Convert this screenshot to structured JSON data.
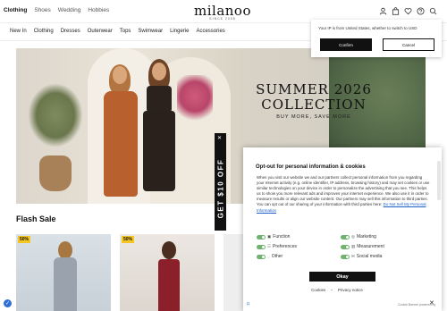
{
  "header": {
    "categories": [
      "Clothing",
      "Shoes",
      "Wedding",
      "Hobbies"
    ],
    "logo_text": "milanoo",
    "logo_since": "SINCE 2008",
    "icons": [
      "user-icon",
      "bag-icon",
      "heart-icon",
      "help-icon",
      "search-icon"
    ]
  },
  "nav": {
    "items": [
      "New In",
      "Clothing",
      "Dresses",
      "Outerwear",
      "Tops",
      "Swimwear",
      "Lingerie",
      "Accessories"
    ]
  },
  "hero": {
    "title_line1": "SUMMER 2026",
    "title_line2": "COLLECTION",
    "subtitle": "BUY MORE, SAVE MORE"
  },
  "promo_tab": {
    "label": "GET $10 OFF",
    "close": "✕"
  },
  "flash_sale": {
    "title": "Flash Sale",
    "cards": [
      {
        "badge": "50%"
      },
      {
        "badge": "50%"
      }
    ]
  },
  "ip_notice": {
    "text": "Your IP is from United States, whether to switch to USD",
    "confirm": "Confirm",
    "cancel": "Cancel"
  },
  "consent": {
    "close": "✕",
    "title": "Opt-out for personal information & cookies",
    "body": "When you visit our website we and our partners collect personal information from you regarding your Internet activity (e.g. online identifier, IP address, browsing history) and may set cookies or use similar technologies on your device in order to personalize the advertising that you see. This helps us to show you more relevant ads and improves your internet experience. We also use it in order to measure results or align our website content. Our partners may sell this information to third parties. You can opt out of our sharing of your information with third parties here:",
    "link": "Do Not Sell My Personal Information",
    "toggles": [
      {
        "label": "Function",
        "on": true
      },
      {
        "label": "Marketing",
        "on": true
      },
      {
        "label": "Preferences",
        "on": true
      },
      {
        "label": "Measurement",
        "on": true
      },
      {
        "label": "Other",
        "on": true
      },
      {
        "label": "Social media",
        "on": true
      }
    ],
    "okay": "Okay",
    "cookies_link": "Cookies",
    "privacy_link": "Privacy notice",
    "powered_by": "Cookie Banner powered by"
  },
  "colors": {
    "accent_black": "#111111",
    "badge_yellow": "#f3c622",
    "toggle_on": "#6fb36f",
    "link_blue": "#1a5dc8"
  }
}
